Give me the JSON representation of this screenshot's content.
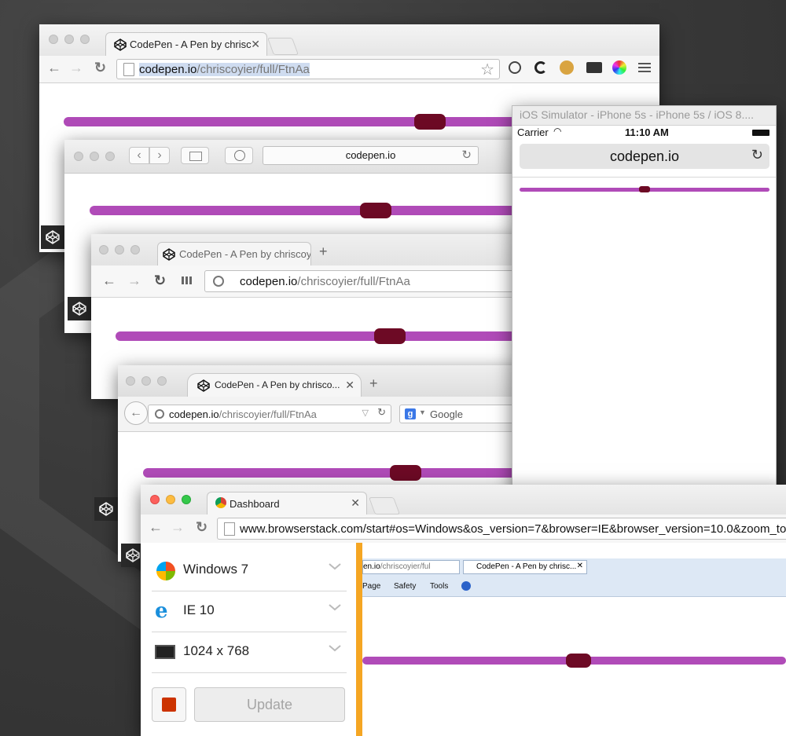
{
  "colors": {
    "slider_track": "#b04bb8",
    "slider_thumb": "#6d0a25",
    "mac_red": "#fc605c",
    "mac_yellow": "#fdbc40",
    "mac_green": "#34c84a",
    "ie_accent": "#f5a623"
  },
  "chrome": {
    "tab_title": "CodePen - A Pen by chrisc",
    "url_host": "codepen.io",
    "url_path": "/chriscoyier/full/FtnAa",
    "slider_value": 0.63
  },
  "safari": {
    "url": "codepen.io",
    "slider_value": 0.65
  },
  "opera": {
    "tab_title": "CodePen - A Pen by chriscoy",
    "url_host": "codepen.io",
    "url_path": "/chriscoyier/full/FtnAa",
    "slider_value": 0.66
  },
  "firefox": {
    "tab_title": "CodePen - A Pen by chrisco...",
    "url_host": "codepen.io",
    "url_path": "/chriscoyier/full/FtnAa",
    "search_placeholder": "Google",
    "slider_value": 0.67
  },
  "ios": {
    "window_title": "iOS Simulator - iPhone 5s - iPhone 5s / iOS 8....",
    "carrier": "Carrier",
    "time": "11:10 AM",
    "url": "codepen.io",
    "slider_value": 0.5
  },
  "browserstack": {
    "tab_title": "Dashboard",
    "url": "www.browserstack.com/start#os=Windows&os_version=7&browser=IE&browser_version=10.0&zoom_to",
    "sidebar": [
      {
        "label": "Windows 7",
        "icon": "windows-icon"
      },
      {
        "label": "IE 10",
        "icon": "ie-icon"
      },
      {
        "label": "1024 x 768",
        "icon": "monitor-icon"
      }
    ],
    "update_label": "Update",
    "ie": {
      "url_host": "en.io",
      "url_path": "/chriscoyier/ful",
      "tab_title": "CodePen - A Pen by chrisc...",
      "menu": [
        "Page",
        "Safety",
        "Tools"
      ],
      "slider_value": 0.51
    }
  }
}
